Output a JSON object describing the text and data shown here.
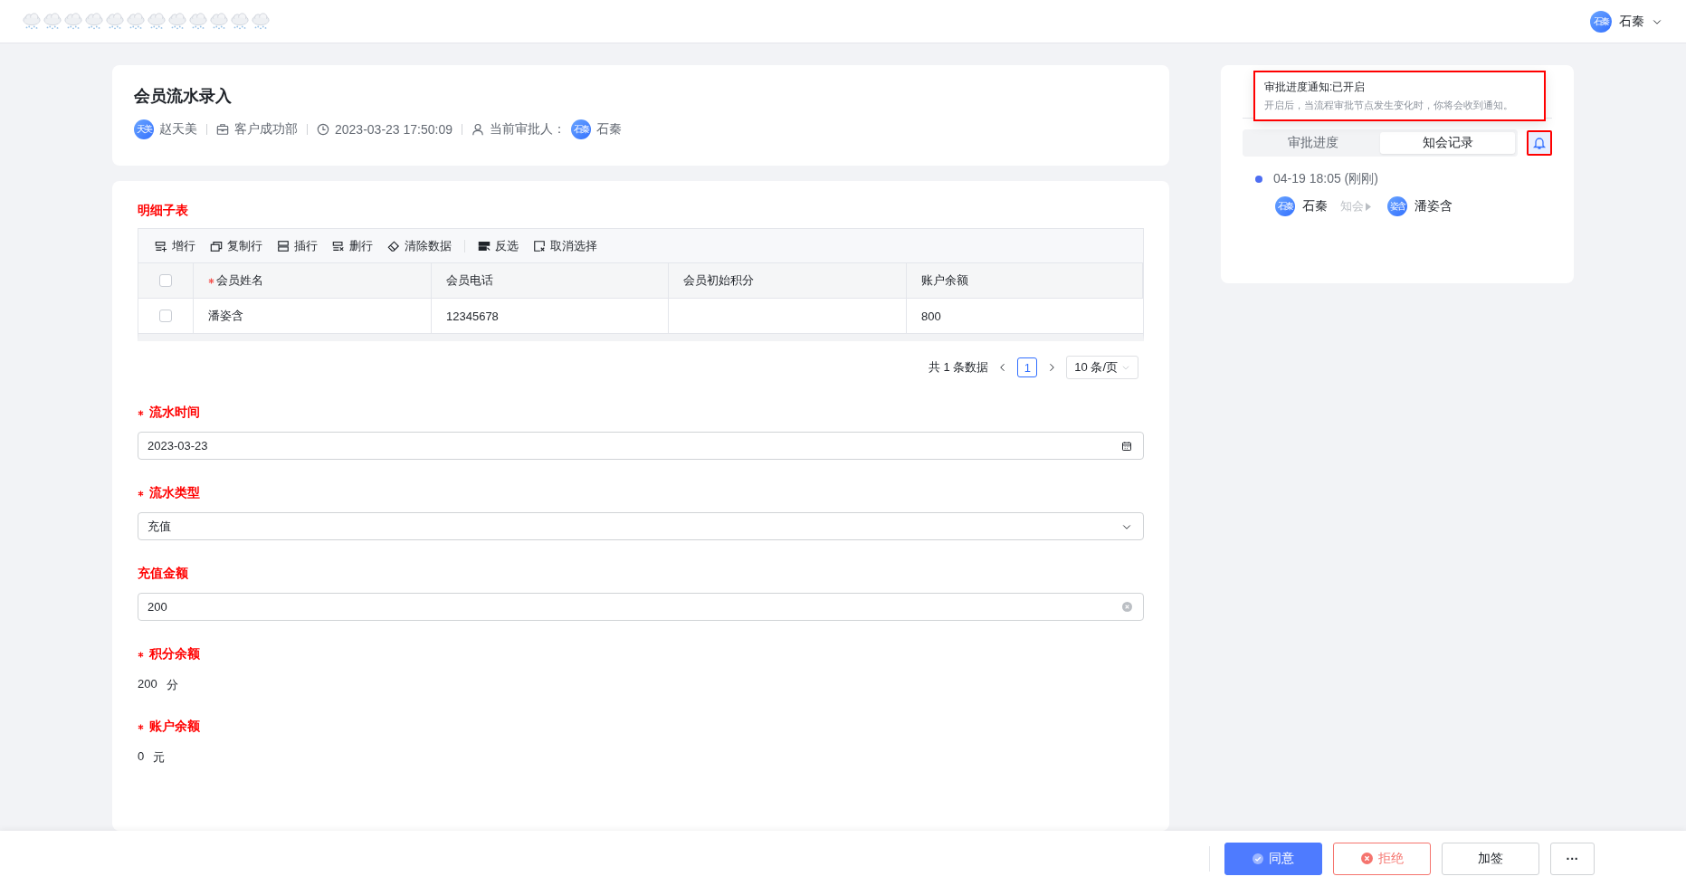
{
  "topbar": {
    "user": {
      "avatar": "石秦",
      "name": "石秦"
    }
  },
  "header": {
    "title": "会员流水录入",
    "meta": [
      {
        "kind": "creator",
        "avatar": "天美",
        "text": "赵天美"
      },
      {
        "kind": "department",
        "text": "客户成功部"
      },
      {
        "kind": "time",
        "text": "2023-03-23 17:50:09"
      },
      {
        "kind": "approver",
        "label": "当前审批人：",
        "avatar": "石秦",
        "text": "石秦"
      }
    ]
  },
  "detail_table": {
    "title": "明细子表",
    "toolbar_groups": [
      {
        "buttons": [
          {
            "kind": "add",
            "label": "增行"
          },
          {
            "kind": "copy",
            "label": "复制行"
          },
          {
            "kind": "insert",
            "label": "插行"
          },
          {
            "kind": "delete",
            "label": "删行"
          },
          {
            "kind": "clear",
            "label": "清除数据"
          }
        ]
      },
      {
        "buttons": [
          {
            "kind": "invert",
            "label": "反选"
          },
          {
            "kind": "deselect",
            "label": "取消选择"
          }
        ]
      }
    ],
    "header_checked": false,
    "columns": [
      {
        "label": "会员姓名",
        "required": true
      },
      {
        "label": "会员电话",
        "required": false
      },
      {
        "label": "会员初始积分",
        "required": false
      },
      {
        "label": "账户余额",
        "required": false
      }
    ],
    "rows": [
      {
        "checked": false,
        "cells": [
          "潘姿含",
          "12345678",
          null,
          "800"
        ]
      }
    ],
    "pagination": {
      "total": "共 1 条数据",
      "pages": [
        {
          "label": "1",
          "selected": true
        }
      ],
      "page_size": "10 条/页"
    }
  },
  "fields": [
    {
      "kind": "date",
      "label": "流水时间",
      "required": true,
      "value": "2023-03-23"
    },
    {
      "kind": "select",
      "label": "流水类型",
      "required": true,
      "value": "充值"
    },
    {
      "kind": "input",
      "label": "充值金额",
      "required": false,
      "value": "200"
    },
    {
      "kind": "text",
      "label": "积分余额",
      "required": true,
      "value": "200",
      "unit": "分"
    },
    {
      "kind": "text",
      "label": "账户余额",
      "required": true,
      "value": "0",
      "unit": "元"
    }
  ],
  "side_panel": {
    "popover": {
      "title": "审批进度通知:已开启",
      "text": "开启后，当流程审批节点发生变化时，你将会收到通知。"
    },
    "tabs": [
      {
        "label": "审批进度",
        "selected": false
      },
      {
        "label": "知会记录",
        "selected": true
      }
    ],
    "notify_on": true,
    "timeline": [
      {
        "time": "04-19 18:05 (刚刚)",
        "from": {
          "avatar": "石秦",
          "name": "石秦"
        },
        "action": "知会",
        "to": {
          "avatar": "姿含",
          "name": "潘姿含"
        }
      }
    ]
  },
  "actions": [
    {
      "kind": "primary",
      "label": "同意"
    },
    {
      "kind": "danger",
      "label": "拒绝"
    },
    {
      "kind": "default",
      "label": "加签"
    },
    {
      "kind": "more",
      "label": "···"
    }
  ]
}
